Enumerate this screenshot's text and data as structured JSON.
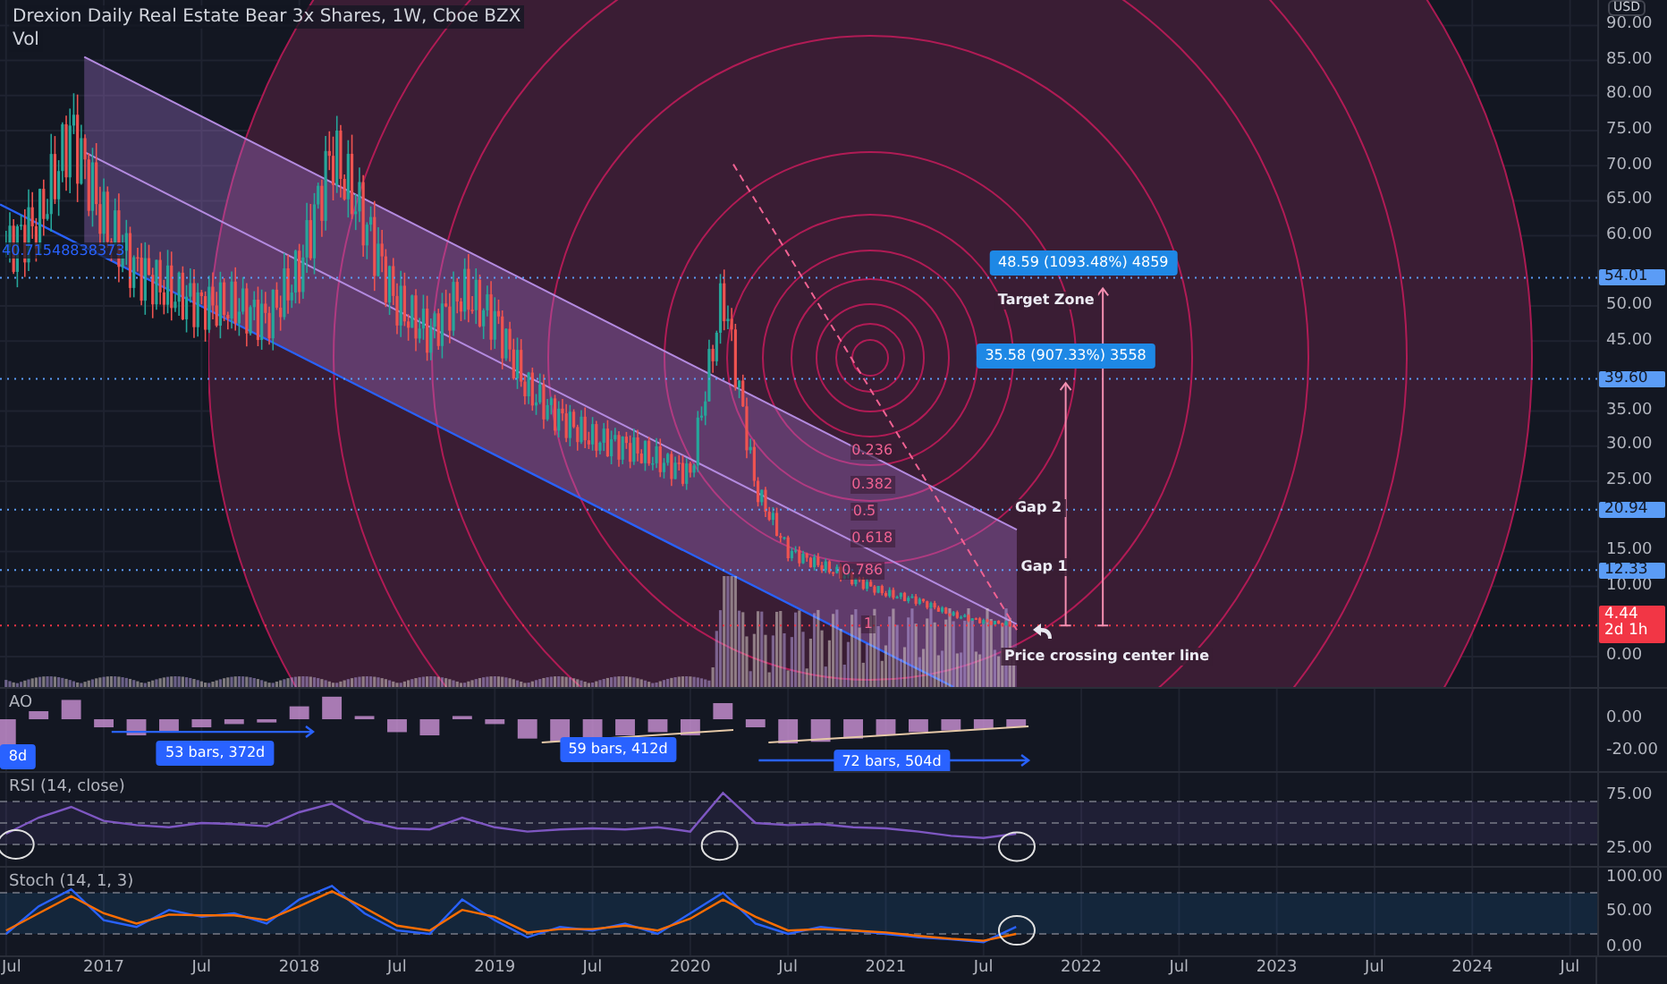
{
  "legend": {
    "title": "Drexion Daily Real Estate Bear 3x Shares, 1W, Cboe BZX",
    "volume_label": "Vol"
  },
  "price_axis": {
    "currency": "USD",
    "ticks": [
      "90.00",
      "85.00",
      "80.00",
      "75.00",
      "70.00",
      "65.00",
      "60.00",
      "50.00",
      "45.00",
      "35.00",
      "30.00",
      "25.00",
      "15.00",
      "10.00",
      "0.00"
    ],
    "level_tags": [
      "54.01",
      "39.60",
      "20.94",
      "12.33"
    ],
    "last_price": "4.44",
    "countdown": "2d 1h"
  },
  "price_pane": {
    "fib_levels": [
      "0.236",
      "0.382",
      "0.5",
      "0.618",
      "0.786",
      "1"
    ],
    "measure_labels": [
      "48.59 (1093.48%) 4859",
      "35.58 (907.33%) 3558"
    ],
    "notes": [
      {
        "kind": "bold",
        "text": "Target Zone"
      },
      {
        "kind": "bold",
        "text": "Gap 2"
      },
      {
        "kind": "bold",
        "text": "Gap 1"
      },
      {
        "kind": "bold",
        "text": "Price crossing center line"
      },
      {
        "kind": "edge",
        "text": "40.71548838373"
      }
    ]
  },
  "indicators": [
    {
      "kind": "ao",
      "label": "AO",
      "axis_labels": [
        "0.00",
        "-20.00"
      ],
      "range_labels": [
        "8d",
        "53 bars, 372d",
        "59 bars, 412d",
        "72 bars, 504d"
      ]
    },
    {
      "kind": "rsi",
      "label": "RSI (14, close)",
      "axis_labels": [
        "75.00",
        "25.00"
      ]
    },
    {
      "kind": "stoch",
      "label": "Stoch (14, 1, 3)",
      "axis_labels": [
        "100.00",
        "50.00",
        "0.00"
      ]
    }
  ],
  "time_axis": {
    "labels": [
      "Jul",
      "2017",
      "Jul",
      "2018",
      "Jul",
      "2019",
      "Jul",
      "2020",
      "Jul",
      "2021",
      "Jul",
      "2022",
      "Jul",
      "2023",
      "Jul",
      "2024",
      "Jul"
    ]
  }
}
